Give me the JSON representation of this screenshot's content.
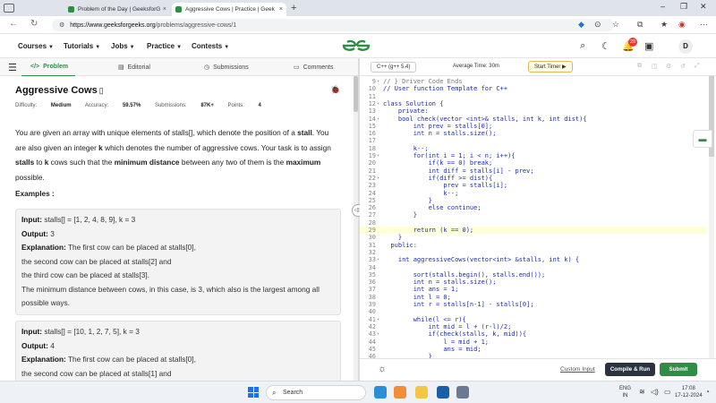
{
  "browser": {
    "tabs": [
      {
        "title": "Problem of the Day | GeeksforGe",
        "close": "×"
      },
      {
        "title": "Aggressive Cows | Practice | Geek",
        "close": "×"
      }
    ],
    "new_tab": "+",
    "url_host": "https://www.geeksforgeeks.org",
    "url_path": "/problems/aggressive-cows/1",
    "win_controls": {
      "minimize": "–",
      "maximize": "❐",
      "close": "✕"
    }
  },
  "nav": {
    "menus": [
      "Courses",
      "Tutorials",
      "Jobs",
      "Practice",
      "Contests"
    ],
    "notification_count": "29",
    "avatar_letter": "D"
  },
  "left_tabs": [
    "Problem",
    "Editorial",
    "Submissions",
    "Comments"
  ],
  "problem": {
    "title": "Aggressive Cows",
    "meta": {
      "difficulty_label": "Difficulty:",
      "difficulty": "Medium",
      "accuracy_label": "Accuracy:",
      "accuracy": "59.57%",
      "submissions_label": "Submissions:",
      "submissions": "87K+",
      "points_label": "Points:",
      "points": "4"
    },
    "desc": {
      "p1": "You are given an array with unique elements of stalls[], which denote the position of a ",
      "p1b": "stall",
      "p2": ". You are also given an integer ",
      "p2b": "k",
      "p3": " which denotes the number of aggressive cows. Your task is to assign ",
      "p3b": "stalls",
      "p4": " to ",
      "p4b": "k",
      "p5": " cows such that the ",
      "p5b": "minimum distance",
      "p6": " between any two of them is the ",
      "p6b": "maximum",
      "p7": " possible."
    },
    "examples_title": "Examples :",
    "examples": [
      {
        "input_label": "Input:",
        "input": " stalls[] = [1, 2, 4, 8, 9], k = 3",
        "output_label": "Output:",
        "output": " 3",
        "expl_label": "Explanation:",
        "expl_1": " The first cow can be placed at stalls[0],",
        "expl_2": "the second cow can be placed at stalls[2] and",
        "expl_3": "the third cow can be placed at stalls[3].",
        "expl_4": "The minimum distance between cows, in this case, is 3, which also is the largest among all possible ways."
      },
      {
        "input_label": "Input:",
        "input": " stalls[] = [10, 1, 2, 7, 5], k = 3",
        "output_label": "Output:",
        "output": " 4",
        "expl_label": "Explanation:",
        "expl_1": " The first cow can be placed at stalls[0],",
        "expl_2": "the second cow can be placed at stalls[1] and"
      }
    ]
  },
  "editor": {
    "language": "C++ (g++ 5.4)",
    "avg_time": "Average Time: 30m",
    "start_timer": "Start Timer",
    "lines": [
      {
        "n": "9",
        "fold": "▾",
        "code": "// } Driver Code Ends"
      },
      {
        "n": "10",
        "fold": "",
        "code": "// User function Template for C++"
      },
      {
        "n": "11",
        "fold": "",
        "code": ""
      },
      {
        "n": "12",
        "fold": "▾",
        "code": "class Solution {"
      },
      {
        "n": "13",
        "fold": "",
        "code": "    private:"
      },
      {
        "n": "14",
        "fold": "▾",
        "code": "    bool check(vector <int>& stalls, int k, int dist){"
      },
      {
        "n": "15",
        "fold": "",
        "code": "        int prev = stalls[0];"
      },
      {
        "n": "16",
        "fold": "",
        "code": "        int n = stalls.size();"
      },
      {
        "n": "17",
        "fold": "",
        "code": ""
      },
      {
        "n": "18",
        "fold": "",
        "code": "        k--;"
      },
      {
        "n": "19",
        "fold": "▾",
        "code": "        for(int i = 1; i < n; i++){"
      },
      {
        "n": "20",
        "fold": "",
        "code": "            if(k == 0) break;"
      },
      {
        "n": "21",
        "fold": "",
        "code": "            int diff = stalls[i] - prev;"
      },
      {
        "n": "22",
        "fold": "▾",
        "code": "            if(diff >= dist){"
      },
      {
        "n": "23",
        "fold": "",
        "code": "                prev = stalls[i];"
      },
      {
        "n": "24",
        "fold": "",
        "code": "                k--;"
      },
      {
        "n": "25",
        "fold": "",
        "code": "            }"
      },
      {
        "n": "26",
        "fold": "",
        "code": "            else continue;"
      },
      {
        "n": "27",
        "fold": "",
        "code": "        }"
      },
      {
        "n": "28",
        "fold": "",
        "code": ""
      },
      {
        "n": "29",
        "fold": "",
        "code": "        return (k == 0);"
      },
      {
        "n": "30",
        "fold": "",
        "code": "    }"
      },
      {
        "n": "31",
        "fold": "",
        "code": "  public:"
      },
      {
        "n": "32",
        "fold": "",
        "code": ""
      },
      {
        "n": "33",
        "fold": "▾",
        "code": "    int aggressiveCows(vector<int> &stalls, int k) {"
      },
      {
        "n": "34",
        "fold": "",
        "code": ""
      },
      {
        "n": "35",
        "fold": "",
        "code": "        sort(stalls.begin(), stalls.end());"
      },
      {
        "n": "36",
        "fold": "",
        "code": "        int n = stalls.size();"
      },
      {
        "n": "37",
        "fold": "",
        "code": "        int ans = 1;"
      },
      {
        "n": "38",
        "fold": "",
        "code": "        int l = 0;"
      },
      {
        "n": "39",
        "fold": "",
        "code": "        int r = stalls[n-1] - stalls[0];"
      },
      {
        "n": "40",
        "fold": "",
        "code": ""
      },
      {
        "n": "41",
        "fold": "▾",
        "code": "        while(l <= r){"
      },
      {
        "n": "42",
        "fold": "",
        "code": "            int mid = l + (r-l)/2;"
      },
      {
        "n": "43",
        "fold": "▾",
        "code": "            if(check(stalls, k, mid)){"
      },
      {
        "n": "44",
        "fold": "",
        "code": "                l = mid + 1;"
      },
      {
        "n": "45",
        "fold": "",
        "code": "                ans = mid;"
      },
      {
        "n": "46",
        "fold": "",
        "code": "            }"
      }
    ],
    "custom_input": "Custom Input",
    "compile_run": "Compile & Run",
    "submit": "Submit"
  },
  "taskbar": {
    "search_placeholder": "Search",
    "lang": "ENG",
    "region": "IN",
    "time": "17:08",
    "date": "17-12-2024"
  },
  "colors": {
    "brand": "#2f8d46",
    "keyword": "#1e2bb0",
    "dark_button": "#2b3340"
  }
}
